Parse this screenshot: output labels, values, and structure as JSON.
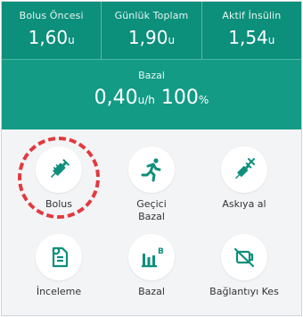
{
  "header": {
    "stats": [
      {
        "label": "Bolus Öncesi",
        "value": "1,60",
        "unit": "u"
      },
      {
        "label": "Günlük Toplam",
        "value": "1,90",
        "unit": "u"
      },
      {
        "label": "Aktif İnsülin",
        "value": "1,54",
        "unit": "u"
      }
    ],
    "basal": {
      "label": "Bazal",
      "value": "0,40",
      "unit": "u/h",
      "percent": "100",
      "percent_unit": "%"
    }
  },
  "menu": [
    {
      "label": "Bolus",
      "icon": "syringe-icon"
    },
    {
      "label": "Geçici\nBazal",
      "icon": "running-person-icon"
    },
    {
      "label": "Askıya al",
      "icon": "syringe-cancel-icon"
    },
    {
      "label": "İnceleme",
      "icon": "report-icon"
    },
    {
      "label": "Bazal",
      "icon": "basal-chart-icon"
    },
    {
      "label": "Bağlantıyı Kes",
      "icon": "disconnect-icon"
    }
  ],
  "colors": {
    "header": "#0c8f7b",
    "basal_band": "#139b86",
    "icon": "#0e8f7b",
    "highlight": "#e23a3f"
  }
}
